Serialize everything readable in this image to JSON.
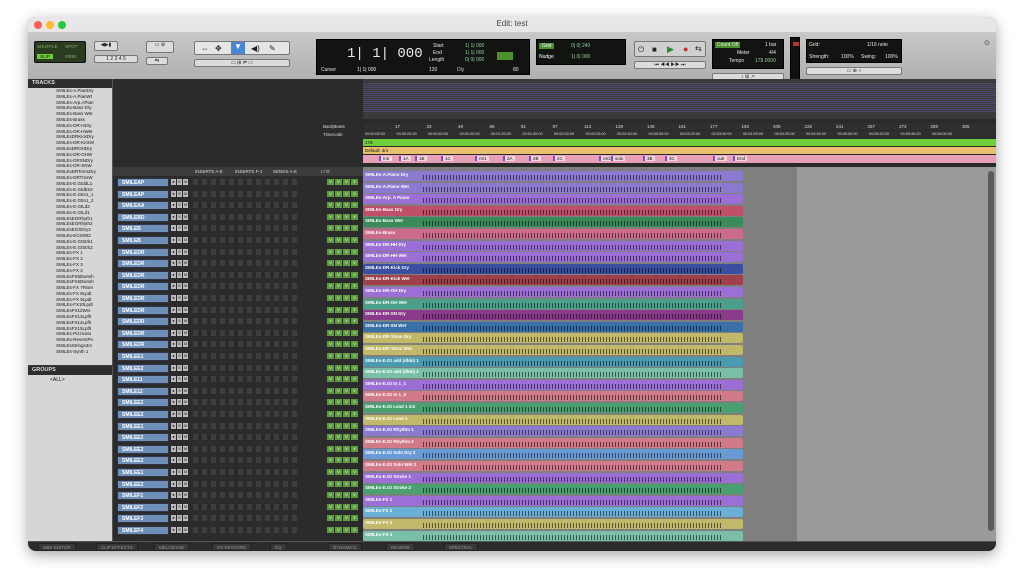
{
  "window": {
    "title": "Edit: test"
  },
  "toolbar": {
    "shuffle": "SHUFFLE",
    "spot": "SPOT",
    "slip": "SLIP",
    "grid": "GRID",
    "counter": "1| 1| 000",
    "cursor_label": "Cursor",
    "cursor_val": "1| 1| 000",
    "start_label": "Start",
    "end_label": "End",
    "length_label": "Length",
    "start_val": "1| 1| 000",
    "end_val": "1| 1| 000",
    "length_val": "0| 0| 000",
    "tempo_small": "120",
    "dly": "Dly",
    "val_80": "80",
    "grid_btn": "Grid",
    "grid_val": "0| 0| 240",
    "nudge_btn": "Nudge",
    "nudge_val": "1| 0| 000",
    "countoff": "Count Off",
    "countoff_val": "1 bar",
    "meter": "Meter",
    "meter_val": "4/4",
    "tempo": "Tempo",
    "tempo_val": "178.0000",
    "grid_right": "Grid:",
    "grid_right_val": "1/16 note",
    "strength": "Strength:",
    "strength_val": "100%",
    "swing": "Swing:",
    "swing_val": "100%"
  },
  "tracks_panel": {
    "title": "TRACKS",
    "items": [
      "SMILEs-A.PianDry",
      "SMILEs-A.PianWt",
      "SMILEs-Arp.APian",
      "SMILEs-Bass Dry",
      "SMILEs-Bass Wet",
      "SMILEs-Brass",
      "SMILEs-DR-HDry",
      "SMILEs-DR-HWet",
      "SMILEsDRKickDry",
      "SMILEs-DR-KickW",
      "SMILEsDROHDry",
      "SMILEs-DR-OHW",
      "SMILEs-DRSNDry",
      "SMILEs-DR-SNW",
      "SMILEsDRTomsDry",
      "SMILEs-DRTmsW",
      "SMILEs-E.GtddL1",
      "SMILEs-E.GtdbS2",
      "SMILEs-E.GtIn1_1",
      "SMILEs-E.GtIn1_2",
      "SMILEs-E.GtLd2",
      "SMILEs-E.GtLd1",
      "SMILEsEGRhyth1",
      "SMILEsEGRhyth2",
      "SMILEsEGSDry2",
      "SMILEs-EGSWt2",
      "SMILEs-E.GtStrk1",
      "SMILEs-E.GtStrk2",
      "SMILEs-FX 1",
      "SMILEs-FX 2",
      "SMILEs-FX 3",
      "SMILEs-FX 4",
      "SMILEsFX5Dwnsh",
      "SMILEsFX6Dwnsh",
      "SMILEs-FX 7Riser",
      "SMILEs-FX 8Lpdt",
      "SMILEs-FX 9Lpdt",
      "SMILEs-FX10Lpdt",
      "SMILEsFX12Wrs",
      "SMILEsFX13Lpflt",
      "SMILEsFX14Lpflt",
      "SMILEsFX15Lpflt",
      "SMILEs-Pizzicato",
      "SMILEs-ReversPn",
      "SMILEsStrings3ct",
      "SMILEs-Synth 1"
    ]
  },
  "groups_panel": {
    "title": "GROUPS",
    "all": "<ALL>"
  },
  "mix_headers": {
    "inserts_ae": "INSERTS A-E",
    "inserts_fj": "INSERTS F-J",
    "sends_ae": "SENDS A-E",
    "io": "I / O"
  },
  "mixer_tracks": [
    "SMILEAP",
    "SMILEAP",
    "SMILEAA",
    "SMILEBD",
    "SMILEB",
    "SMILEB",
    "SMILEDR",
    "SMILEDR",
    "SMILEDR",
    "SMILEDR",
    "SMILEDR",
    "SMILEDR",
    "SMILEDR",
    "SMILEDR",
    "SMILEDR",
    "SMILEE1",
    "SMILEE2",
    "SMILE11",
    "SMILE12",
    "SMILEE2",
    "SMILEE2",
    "SMILEE1",
    "SMILEE2",
    "SMILEE2",
    "SMILEE2",
    "SMILEE1",
    "SMILEE2",
    "SMILEF1",
    "SMILEF2",
    "SMILEF3",
    "SMILEF4"
  ],
  "rulers": {
    "bars_beats": "Bars|Beats",
    "timecode": "Timecode",
    "tempo": "Tempo",
    "meter": "Meter",
    "markers": [
      "Intr",
      "1A",
      "1B",
      "1C",
      "ntr1",
      "2A",
      "2B",
      "2C",
      "ntr2",
      "solo",
      "3B",
      "3C",
      "outr",
      "End"
    ],
    "tempo_val": "178",
    "meter_val": "Default: 4/4",
    "bars": [
      "17",
      "33",
      "49",
      "65",
      "81",
      "97",
      "113",
      "129",
      "145",
      "161",
      "177",
      "193",
      "209",
      "225",
      "241",
      "257",
      "273",
      "289",
      "305"
    ],
    "times": [
      "00:00:00:00",
      "00:00:20:00",
      "00:00:40:00",
      "00:01:00:00",
      "00:01:20:00",
      "00:01:40:00",
      "00:02:00:00",
      "00:02:20:00",
      "00:02:40:00",
      "00:03:00:00",
      "00:03:20:00",
      "00:03:40:00",
      "00:04:00:00",
      "00:04:20:00",
      "00:04:40:00",
      "00:05:00:00",
      "00:05:20:00",
      "00:05:40:00",
      "00:06:00:00"
    ]
  },
  "clips": [
    {
      "name": "SMILEs-A.Piano Dry",
      "color": "#8c7ad1"
    },
    {
      "name": "SMILEs-A.Piano Wet",
      "color": "#8c7ad1"
    },
    {
      "name": "SMILEs-Arp. A Piano",
      "color": "#9b6fd6"
    },
    {
      "name": "SMILEs-Bass Dry",
      "color": "#c0506a"
    },
    {
      "name": "SMILEs-Bass Wet",
      "color": "#3b8a5c"
    },
    {
      "name": "SMILEs-Brass",
      "color": "#cc6a8a"
    },
    {
      "name": "SMILEs-DR-HH Dry",
      "color": "#9b6fd6"
    },
    {
      "name": "SMILEs-DR-HH Wet",
      "color": "#9b6fd6"
    },
    {
      "name": "SMILEs-DR-Kick Dry",
      "color": "#3a4fa0"
    },
    {
      "name": "SMILEs-DR-Kick Wet",
      "color": "#a0404a"
    },
    {
      "name": "SMILEs-DR-OH Dry",
      "color": "#9b6fd6"
    },
    {
      "name": "SMILEs-DR-OH Wet",
      "color": "#4aa08a"
    },
    {
      "name": "SMILEs-DR-SN Dry",
      "color": "#8a3a8a"
    },
    {
      "name": "SMILEs-DR-SN Wet",
      "color": "#3a70a8"
    },
    {
      "name": "SMILEs-DR-Toms Dry",
      "color": "#c2b86a"
    },
    {
      "name": "SMILEs-DR-Toms Wet",
      "color": "#c2b86a"
    },
    {
      "name": "SMILEs-E.Gt add (dbbl) 1",
      "color": "#4a9ab0"
    },
    {
      "name": "SMILEs-E.Gt add (dbbl) 2",
      "color": "#7ac0a8"
    },
    {
      "name": "SMILEs-E.Gt In 1_1",
      "color": "#9b6fd6"
    },
    {
      "name": "SMILEs-E.Gt In 1_2",
      "color": "#d07a8a"
    },
    {
      "name": "SMILEs-E.Gt Lead 1 in2",
      "color": "#4aa070"
    },
    {
      "name": "SMILEs-E.Gt Lead 2",
      "color": "#c2b86a"
    },
    {
      "name": "SMILEs-E.Gt Rhythm 1",
      "color": "#8c7ad1"
    },
    {
      "name": "SMILEs-E.Gt Rhythm 2",
      "color": "#d07a8a"
    },
    {
      "name": "SMILEs-E.Gt Solo Dry 2",
      "color": "#6a9ad6"
    },
    {
      "name": "SMILEs-E.Gt Solo Wet 2",
      "color": "#d07a8a"
    },
    {
      "name": "SMILEs-E.Gt Stroke 1",
      "color": "#9b6fd6"
    },
    {
      "name": "SMILEs-E.Gt Stroke 2",
      "color": "#4aa070"
    },
    {
      "name": "SMILEs-FX 1",
      "color": "#9b6fd6"
    },
    {
      "name": "SMILEs-FX 2",
      "color": "#6ab0d6"
    },
    {
      "name": "SMILEs-FX 3",
      "color": "#c2b86a"
    },
    {
      "name": "SMILEs-FX 4",
      "color": "#7ac0a8"
    }
  ],
  "bottom_tabs": [
    "MIDI EDITOR",
    "CLIP EFFECTS",
    "MELODYNE",
    "RX RESTORE",
    "EQ",
    "DYNAMICS",
    "REVERB",
    "SPECTRAL"
  ]
}
